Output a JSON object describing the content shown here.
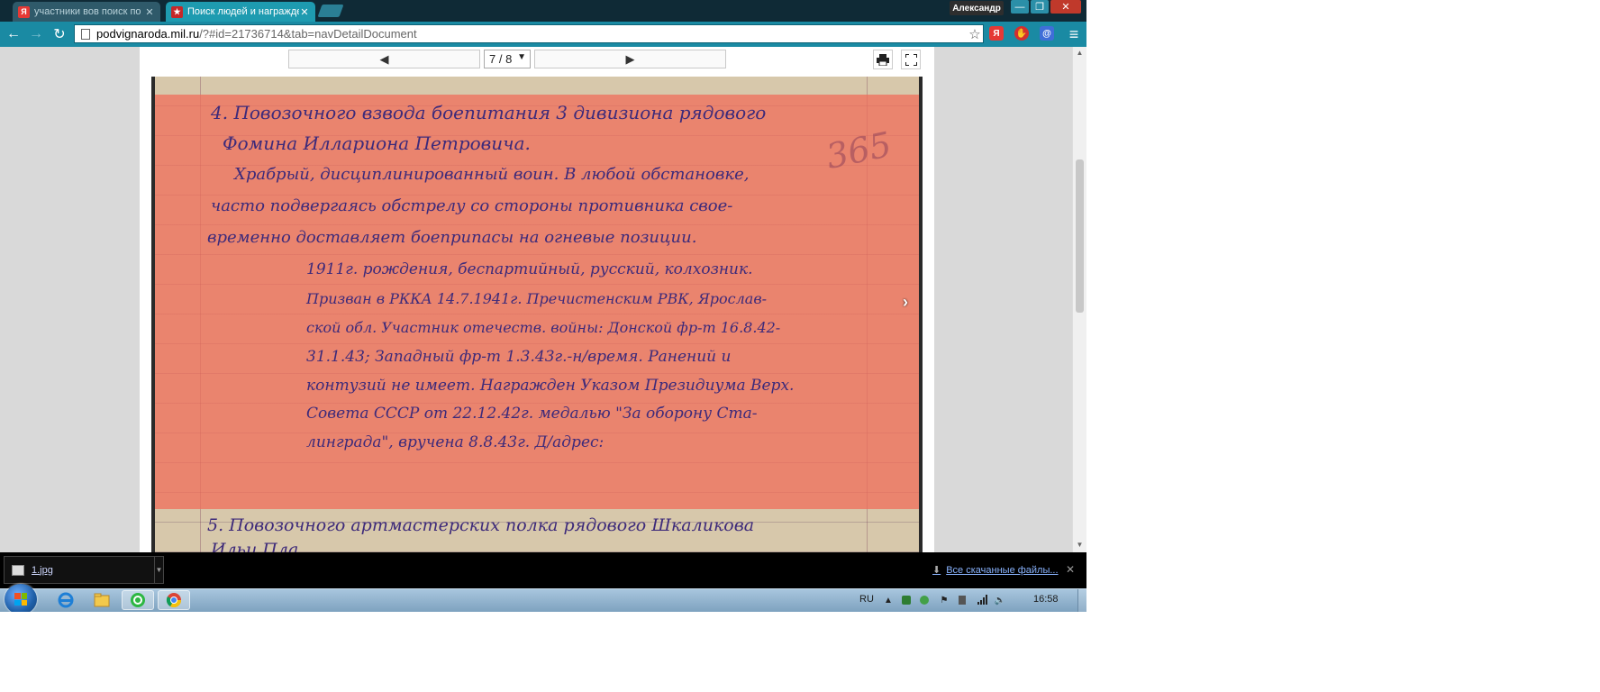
{
  "tabs": [
    {
      "title": "участники вов поиск по фам",
      "favicon": "yandex-icon",
      "favicon_letter": "Я",
      "active": false
    },
    {
      "title": "Поиск людей и награжде",
      "favicon": "podvig-star-icon",
      "favicon_letter": "★",
      "active": true
    }
  ],
  "user": {
    "name": "Александр"
  },
  "window_buttons": {
    "minimize": "—",
    "restore": "❐",
    "close": "✕"
  },
  "nav": {
    "back": "←",
    "forward": "→",
    "reload": "↻"
  },
  "omnibox": {
    "host": "podvignaroda.mil.ru",
    "path": "/?#id=21736714&tab=navDetailDocument",
    "star": "☆"
  },
  "extensions": [
    {
      "name": "yandex-extension-icon",
      "label": "Я",
      "color": "#e53935"
    },
    {
      "name": "adblock-icon",
      "label": "✋",
      "color": "#d32f2f"
    },
    {
      "name": "mail-extension-icon",
      "label": "@",
      "color": "#3f6ed8"
    }
  ],
  "menu_icon": "≡",
  "viewer": {
    "prev": "◀",
    "next": "▶",
    "page_indicator": "7 / 8",
    "page_dropdown_arrow": "▼",
    "side_next": "›"
  },
  "document": {
    "lines": [
      "4. Повозочного взвода боепитания 3 дивизиона рядового",
      "Фомина Иллариона Петровича.",
      "Храбрый, дисциплинированный воин. В любой обстановке,",
      "часто подвергаясь обстрелу со стороны противника свое-",
      "временно доставляет боеприпасы на огневые позиции.",
      "1911г. рождения, беспартийный, русский, колхозник.",
      "Призван в РККА 14.7.1941г. Пречистенским РВК, Ярослав-",
      "ской обл. Участник отечеств. войны: Донской фр-т 16.8.42-",
      "31.1.43; Западный фр-т 1.3.43г.-н/время. Ранений и",
      "контузий не имеет. Награжден Указом Президиума Верх.",
      "Совета СССР от 22.12.42г. медалью \"За оборону Ста-",
      "линграда\", вручена 8.8.43г. Д/адрес:",
      "5. Повозочного артмастерских полка рядового Шкаликова",
      "Ильи Пла..."
    ],
    "margin_number": "365"
  },
  "downloads": {
    "file_name": "1.jpg",
    "show_all": "Все скачанные файлы...",
    "close": "✕"
  },
  "taskbar": {
    "language": "RU",
    "time": "16:58"
  }
}
